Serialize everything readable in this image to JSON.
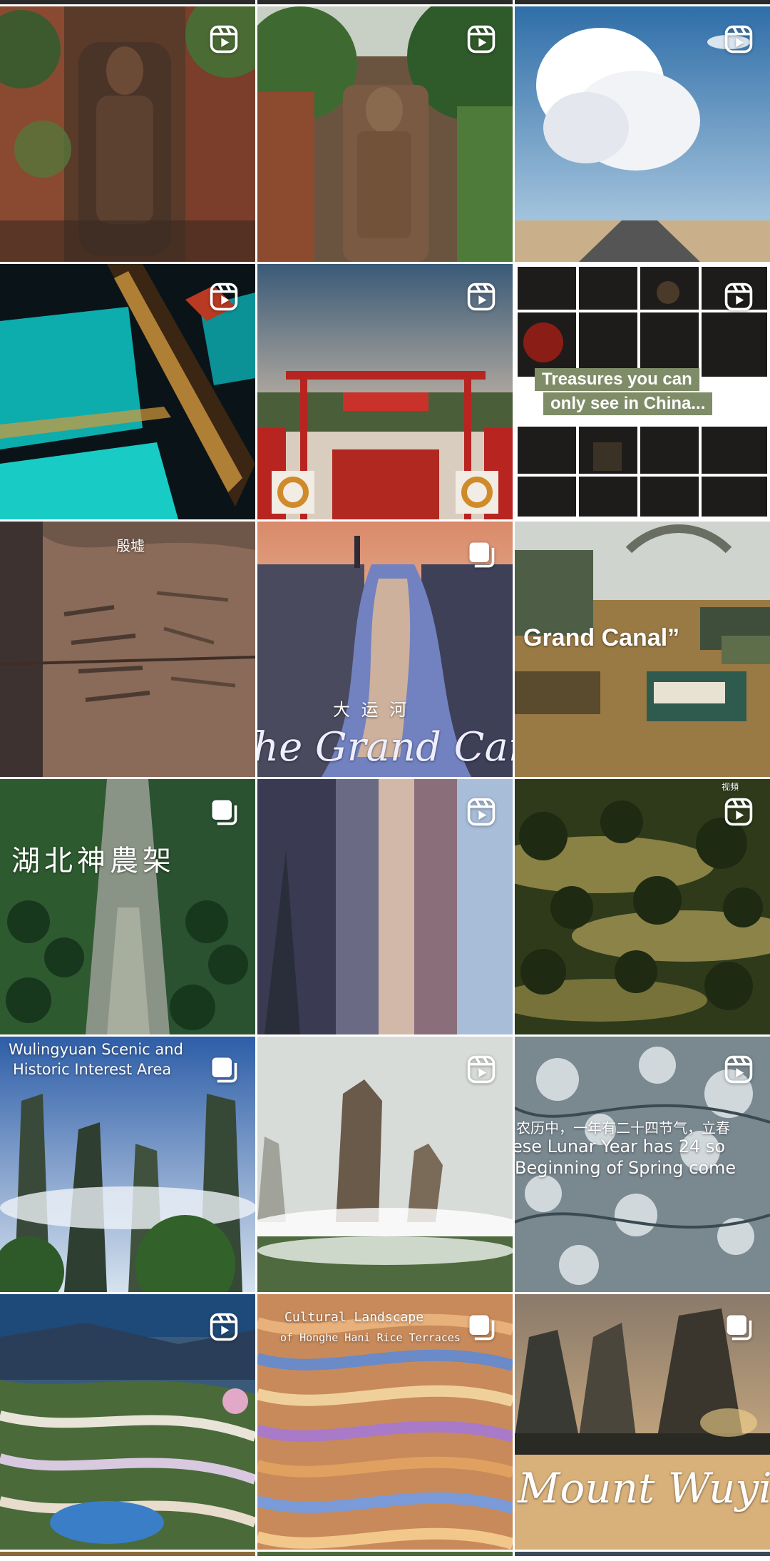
{
  "grid": {
    "tiles": [
      {
        "id": "buddha-cliff-1",
        "badge": "reel-icon",
        "overlay": []
      },
      {
        "id": "buddha-cliff-2",
        "badge": "reel-icon",
        "overlay": []
      },
      {
        "id": "cloud-road",
        "badge": "reel-icon",
        "overlay": []
      },
      {
        "id": "turquoise-pools-night",
        "badge": "reel-icon",
        "overlay": []
      },
      {
        "id": "red-gate",
        "badge": "reel-icon",
        "overlay": []
      },
      {
        "id": "treasures-collage",
        "badge": "reel-icon",
        "overlay": [
          "Treasures you can",
          "only see in China..."
        ]
      },
      {
        "id": "carved-stone",
        "badge": "none",
        "overlay": [
          "殷墟"
        ]
      },
      {
        "id": "grand-canal-river",
        "badge": "multi-icon",
        "overlay": [
          "大 运 河",
          "he Grand Can"
        ]
      },
      {
        "id": "grand-canal-boats",
        "badge": "none",
        "overlay": [
          "Grand Canal”"
        ]
      },
      {
        "id": "shennongjia-forest",
        "badge": "multi-icon",
        "overlay": [
          "湖北神農架"
        ]
      },
      {
        "id": "misty-canyon",
        "badge": "reel-icon",
        "overlay": []
      },
      {
        "id": "golden-forest",
        "badge": "reel-icon",
        "overlay": [
          "视頻"
        ]
      },
      {
        "id": "wulingyuan",
        "badge": "multi-icon",
        "overlay": [
          "Wulingyuan Scenic and",
          "Historic Interest Area"
        ]
      },
      {
        "id": "karst-mist",
        "badge": "reel-icon",
        "overlay": []
      },
      {
        "id": "frost-branches",
        "badge": "reel-icon",
        "overlay": [
          "农历中，一年有二十四节气，立春",
          "ese Lunar Year has 24 so",
          "Beginning of Spring come"
        ]
      },
      {
        "id": "rice-terraces",
        "badge": "reel-icon",
        "overlay": []
      },
      {
        "id": "hani-terraces",
        "badge": "multi-icon",
        "overlay": [
          "Cultural Landscape",
          "of Honghe Hani Rice Terraces"
        ]
      },
      {
        "id": "mount-wuyi",
        "badge": "multi-icon",
        "overlay": [
          "Mount Wuyi"
        ]
      }
    ]
  },
  "colors": {
    "reel_badge": "#ffffff",
    "overlay_box": "#7f8c68"
  }
}
